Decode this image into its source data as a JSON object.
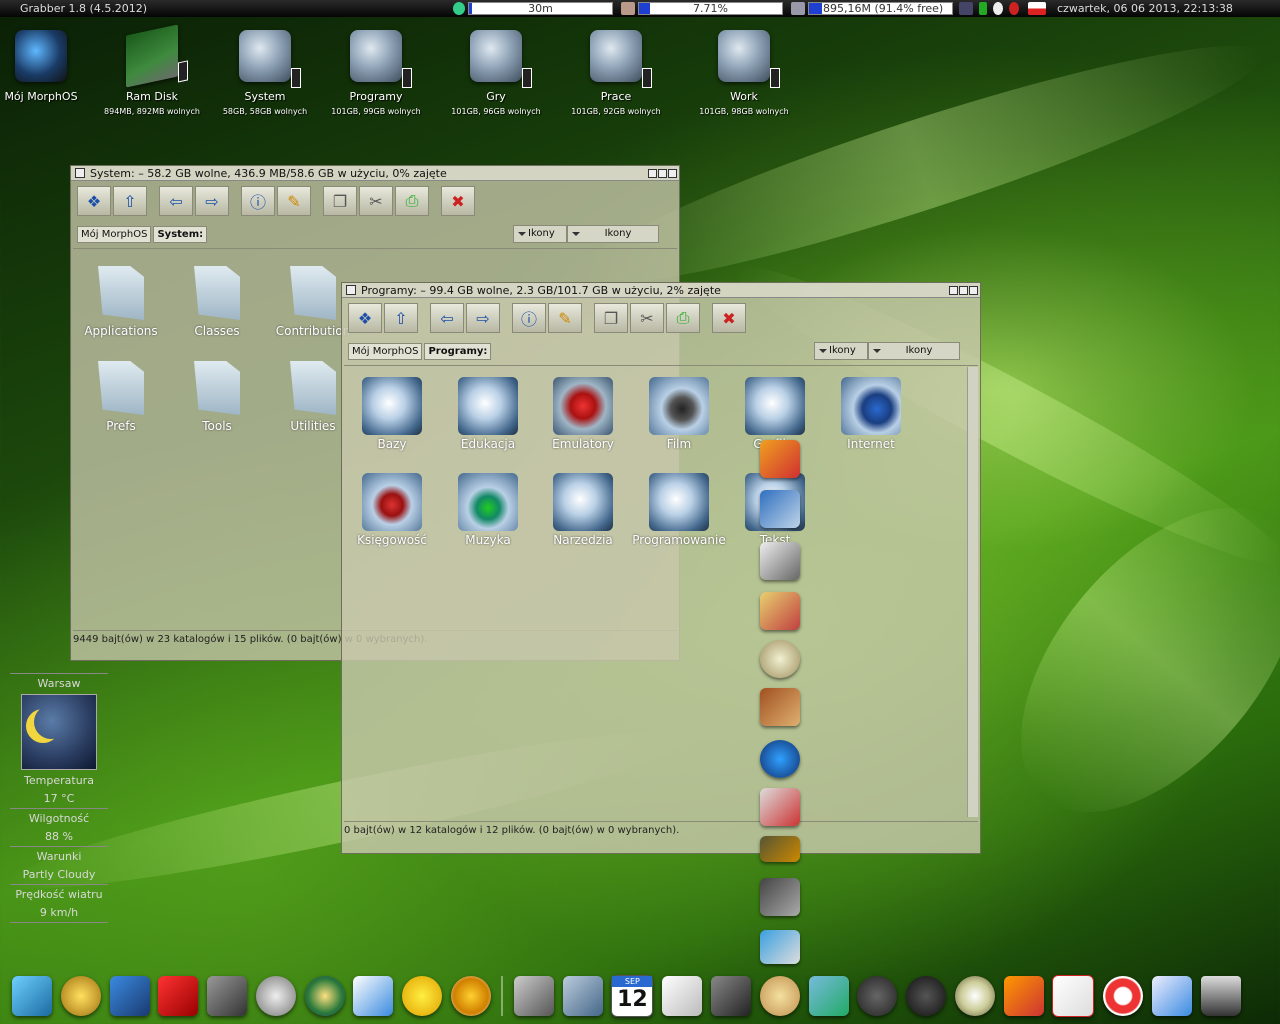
{
  "topbar": {
    "app_title": "Grabber 1.8 (4.5.2012)",
    "cpu_meter": "30m",
    "cpu_fraction": 0.02,
    "load_meter": "7.71%",
    "load_fraction": 0.08,
    "memory_meter": "895,16M (91.4% free)",
    "memory_fraction": 0.09,
    "datetime": "czwartek, 06 06 2013, 22:13:38"
  },
  "desktop_icons": [
    {
      "name": "Mój MorphOS",
      "sub": ""
    },
    {
      "name": "Ram Disk",
      "sub": "894MB, 892MB wolnych"
    },
    {
      "name": "System",
      "sub": "58GB, 58GB wolnych"
    },
    {
      "name": "Programy",
      "sub": "101GB, 99GB wolnych"
    },
    {
      "name": "Gry",
      "sub": "101GB, 96GB wolnych"
    },
    {
      "name": "Prace",
      "sub": "101GB, 92GB wolnych"
    },
    {
      "name": "Work",
      "sub": "101GB, 98GB wolnych"
    }
  ],
  "system_window": {
    "title": "System: – 58.2 GB wolne, 436.9 MB/58.6 GB w użyciu, 0% zajęte",
    "path_root": "Mój MorphOS",
    "path_current": "System:",
    "view_mode_1": "Ikony",
    "view_mode_2": "Ikony",
    "icons": [
      "Applications",
      "Classes",
      "Contribution",
      "Prefs",
      "Tools",
      "Utilities"
    ],
    "status": "9449 bajt(ów) w 23 katalogów i 15 plików. (0 bajt(ów) w 0 wybranych)."
  },
  "programy_window": {
    "title": "Programy: – 99.4 GB wolne, 2.3 GB/101.7 GB w użyciu, 2% zajęte",
    "path_root": "Mój MorphOS",
    "path_current": "Programy:",
    "view_mode_1": "Ikony",
    "view_mode_2": "Ikony",
    "icons": [
      "Bazy",
      "Edukacja",
      "Emulatory",
      "Film",
      "Grafika",
      "Internet",
      "Księgowość",
      "Muzyka",
      "Narzedzia",
      "Programowanie",
      "Tekst"
    ],
    "status": "0 bajt(ów) w 12 katalogów i 12 plików. (0 bajt(ów) w 0 wybranych)."
  },
  "weather": {
    "city": "Warsaw",
    "temp_label": "Temperatura",
    "temp_value": "17 °C",
    "humidity_label": "Wilgotność",
    "humidity_value": "88 %",
    "conditions_label": "Warunki",
    "conditions_value": "Partly Cloudy",
    "wind_label": "Prędkość wiatru",
    "wind_value": "9 km/h"
  },
  "calendar_day": "12",
  "calendar_month": "SEP"
}
